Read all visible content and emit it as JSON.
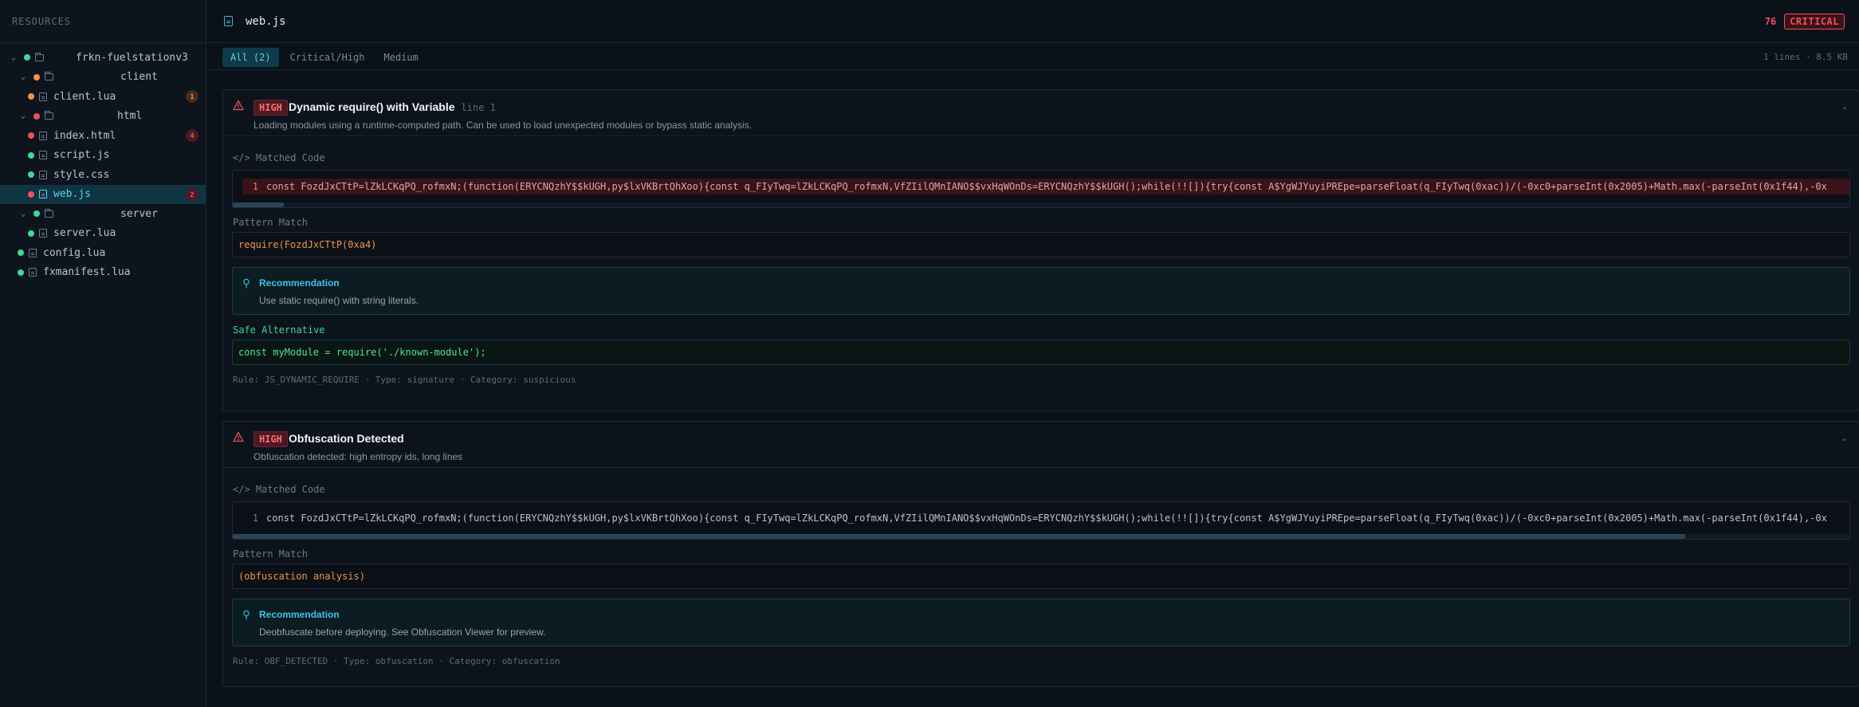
{
  "sidebar": {
    "header": "RESOURCES",
    "tree": [
      {
        "name": "frkn-fuelstationv3",
        "type": "folder",
        "status": "green",
        "expanded": true
      },
      {
        "name": "client",
        "type": "folder",
        "status": "orange",
        "expanded": true
      },
      {
        "name": "client.lua",
        "type": "file",
        "status": "orange",
        "count": "1"
      },
      {
        "name": "html",
        "type": "folder",
        "status": "red",
        "expanded": true
      },
      {
        "name": "index.html",
        "type": "file",
        "status": "red",
        "count": "4"
      },
      {
        "name": "script.js",
        "type": "file",
        "status": "green"
      },
      {
        "name": "style.css",
        "type": "file",
        "status": "green"
      },
      {
        "name": "web.js",
        "type": "file",
        "status": "red",
        "count": "2",
        "selected": true
      },
      {
        "name": "server",
        "type": "folder",
        "status": "green",
        "expanded": true
      },
      {
        "name": "server.lua",
        "type": "file",
        "status": "green"
      },
      {
        "name": "config.lua",
        "type": "file",
        "status": "green"
      },
      {
        "name": "fxmanifest.lua",
        "type": "file",
        "status": "green"
      }
    ]
  },
  "header": {
    "filename": "web.js",
    "score": "76",
    "severity": "CRITICAL"
  },
  "tabs": {
    "items": [
      "All (2)",
      "Critical/High",
      "Medium"
    ],
    "active": 0,
    "meta": "1 lines · 8.5 KB"
  },
  "findings": [
    {
      "severity": "HIGH",
      "title": "Dynamic require() with Variable",
      "line": "line 1",
      "description": "Loading modules using a runtime-computed path. Can be used to load unexpected modules or bypass static analysis.",
      "matched_code_label": "Matched Code",
      "line_number": "1",
      "code": "const FozdJxCTtP=lZkLCKqPQ_rofmxN;(function(ERYCNQzhY$$kUGH,py$lxVKBrtQhXoo){const q_FIyTwq=lZkLCKqPQ_rofmxN,VfZIilQMnIANO$$vxHqWOnDs=ERYCNQzhY$$kUGH();while(!![]){try{const A$YgWJYuyiPREpe=parseFloat(q_FIyTwq(0xac))/(-0xc0+parseInt(0x2005)+Math.max(-parseInt(0x1f44),-0x",
      "pattern_label": "Pattern Match",
      "pattern": "require(FozdJxCTtP(0xa4)",
      "recommendation_label": "Recommendation",
      "recommendation": "Use static require() with string literals.",
      "safe_label": "Safe Alternative",
      "safe_code": "const myModule = require('./known-module');",
      "rule": "Rule: JS_DYNAMIC_REQUIRE · Type: signature · Category: suspicious"
    },
    {
      "severity": "HIGH",
      "title": "Obfuscation Detected",
      "description": "Obfuscation detected: high entropy ids, long lines",
      "matched_code_label": "Matched Code",
      "line_number": "1",
      "code": "const FozdJxCTtP=lZkLCKqPQ_rofmxN;(function(ERYCNQzhY$$kUGH,py$lxVKBrtQhXoo){const q_FIyTwq=lZkLCKqPQ_rofmxN,VfZIilQMnIANO$$vxHqWOnDs=ERYCNQzhY$$kUGH();while(!![]){try{const A$YgWJYuyiPREpe=parseFloat(q_FIyTwq(0xac))/(-0xc0+parseInt(0x2005)+Math.max(-parseInt(0x1f44),-0x",
      "pattern_label": "Pattern Match",
      "pattern": "(obfuscation analysis)",
      "recommendation_label": "Recommendation",
      "recommendation": "Deobfuscate before deploying. See Obfuscation Viewer for preview.",
      "rule": "Rule: OBF_DETECTED · Type: obfuscation · Category: obfuscation"
    }
  ]
}
